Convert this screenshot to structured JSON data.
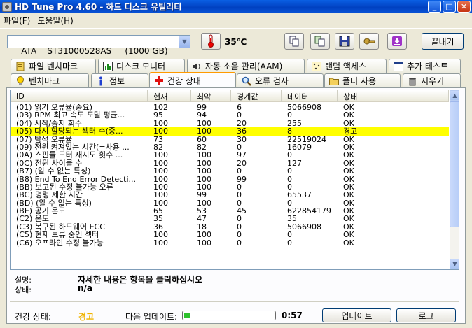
{
  "window": {
    "title": "HD Tune Pro 4.60 - 하드 디스크 유틸리티"
  },
  "menu": [
    "파일(F)",
    "도움말(H)"
  ],
  "toolbar": {
    "drive": "ATA    ST31000528AS     (1000 GB)",
    "temperature": "35℃",
    "exit_label": "끝내기"
  },
  "tabs_top": [
    "파일 벤치마크",
    "디스크 모니터",
    "자동 소음 관리(AAM)",
    "랜덤 액세스",
    "추가 테스트"
  ],
  "tabs_bottom": [
    "벤치마크",
    "정보",
    "건강 상태",
    "오류 검사",
    "폴더 사용",
    "지우기"
  ],
  "active_tab": "건강 상태",
  "table": {
    "columns": [
      "ID",
      "현재",
      "최악",
      "경계값",
      "데이터",
      "상태"
    ],
    "rows": [
      [
        "(01) 읽기 오류율(중요)",
        "102",
        "99",
        "6",
        "5066908",
        "OK"
      ],
      [
        "(03) RPM 최고 속도 도달 평균...",
        "95",
        "94",
        "0",
        "0",
        "OK"
      ],
      [
        "(04) 시작/중지 회수",
        "100",
        "100",
        "20",
        "255",
        "OK"
      ],
      [
        "(05) 다시 할당되는 섹터 수(중...",
        "100",
        "100",
        "36",
        "8",
        "경고"
      ],
      [
        "(07) 탐색 오류율",
        "73",
        "60",
        "30",
        "22519024",
        "OK"
      ],
      [
        "(09) 전원 켜져있는 시간(=사용 ...",
        "82",
        "82",
        "0",
        "16079",
        "OK"
      ],
      [
        "(0A) 스핀들 모터 재시도 횟수 ...",
        "100",
        "100",
        "97",
        "0",
        "OK"
      ],
      [
        "(0C) 전원 사이클 수",
        "100",
        "100",
        "20",
        "127",
        "OK"
      ],
      [
        "(B7) (알 수 없는 특성)",
        "100",
        "100",
        "0",
        "0",
        "OK"
      ],
      [
        "(B8) End To End Error Detecti...",
        "100",
        "100",
        "99",
        "0",
        "OK"
      ],
      [
        "(BB) 보고된 수정 불가능 오류",
        "100",
        "100",
        "0",
        "0",
        "OK"
      ],
      [
        "(BC) 명령 제한 시간",
        "100",
        "99",
        "0",
        "65537",
        "OK"
      ],
      [
        "(BD) (알 수 없는 특성)",
        "100",
        "100",
        "0",
        "0",
        "OK"
      ],
      [
        "(BE) 공기 온도",
        "65",
        "53",
        "45",
        "622854179",
        "OK"
      ],
      [
        "(C2) 온도",
        "35",
        "47",
        "0",
        "35",
        "OK"
      ],
      [
        "(C3) 복구된 하드웨어 ECC",
        "36",
        "18",
        "0",
        "5066908",
        "OK"
      ],
      [
        "(C5) 현재 보류 중인 섹터",
        "100",
        "100",
        "0",
        "0",
        "OK"
      ],
      [
        "(C6) 오프라인 수정 불가능",
        "100",
        "100",
        "0",
        "0",
        "OK"
      ]
    ],
    "warn_row": 3
  },
  "detail": {
    "desc_label": "설명:",
    "desc_value": "자세한 내용은 항목을 클릭하십시오",
    "state_label": "상태:",
    "state_value": "n/a"
  },
  "status": {
    "health_label": "건강 상태:",
    "health_value": "경고",
    "next_update_label": "다음 업데이트:",
    "progress": 0.06,
    "timer": "0:57",
    "update_button": "업데이트",
    "log_button": "로그"
  },
  "colors": {
    "warn_row": "#ffff00",
    "health_warn": "#f0b400",
    "accent_tab": "#ff9a00"
  }
}
